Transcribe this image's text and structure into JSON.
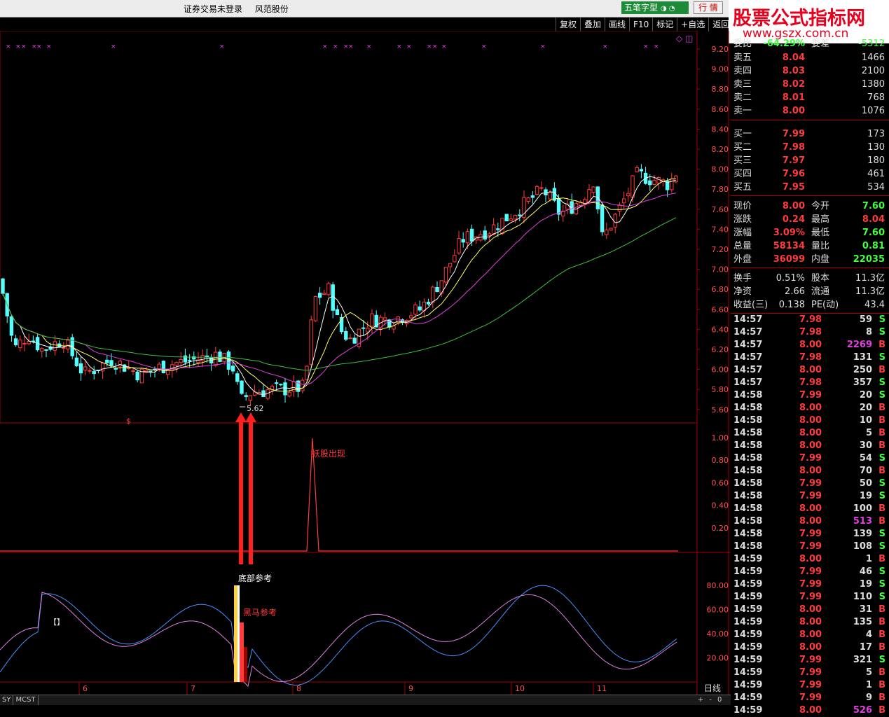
{
  "window": {
    "title_items": [
      "证券交易未登录",
      "风范股份"
    ],
    "ime_label": "五笔字型",
    "market_button": "行 情"
  },
  "logo": {
    "line1": "股票公式指标网",
    "line2": "www.gszx.com.cn"
  },
  "toolbar": [
    "复权",
    "叠加",
    "画线",
    "F10",
    "标记",
    "+自选",
    "返回"
  ],
  "price_axis": [
    "9.20",
    "9.00",
    "8.80",
    "8.60",
    "8.40",
    "8.20",
    "8.00",
    "7.80",
    "7.60",
    "7.40",
    "7.20",
    "7.00",
    "6.80",
    "6.60",
    "6.40",
    "6.20",
    "6.00",
    "5.80",
    "5.60"
  ],
  "ind1_axis": [
    "1.00",
    "0.80",
    "0.60",
    "0.40",
    "0.20"
  ],
  "ind2_axis": [
    "80.00",
    "60.00",
    "40.00",
    "20.00"
  ],
  "month_labels": [
    "6",
    "7",
    "8",
    "9",
    "10",
    "11"
  ],
  "period_label": "日线",
  "chart_labels": {
    "low_price": "5.62",
    "dollar": "$",
    "monster": "妖股出现",
    "bottom_ref": "底部参考",
    "darkhorse_ref": "黑马参考",
    "bracket": "【】"
  },
  "bottom_tabs": [
    "SY",
    "MCST"
  ],
  "bottom_buttons": [
    "+",
    "-",
    "0"
  ],
  "weibi": {
    "label1": "委比",
    "val1": "-64.29%",
    "label2": "委差",
    "val2": "-5312"
  },
  "asks": [
    {
      "label": "卖五",
      "price": "8.04",
      "vol": "1466"
    },
    {
      "label": "卖四",
      "price": "8.03",
      "vol": "2100"
    },
    {
      "label": "卖三",
      "price": "8.02",
      "vol": "1380"
    },
    {
      "label": "卖二",
      "price": "8.01",
      "vol": "768"
    },
    {
      "label": "卖一",
      "price": "8.00",
      "vol": "1076"
    }
  ],
  "bids": [
    {
      "label": "买一",
      "price": "7.99",
      "vol": "173"
    },
    {
      "label": "买二",
      "price": "7.98",
      "vol": "130"
    },
    {
      "label": "买三",
      "price": "7.97",
      "vol": "180"
    },
    {
      "label": "买四",
      "price": "7.96",
      "vol": "461"
    },
    {
      "label": "买五",
      "price": "7.95",
      "vol": "534"
    }
  ],
  "stats": [
    {
      "l1": "现价",
      "v1": "8.00",
      "c1": "red",
      "l2": "今开",
      "v2": "7.60",
      "c2": "green"
    },
    {
      "l1": "涨跌",
      "v1": "0.24",
      "c1": "red",
      "l2": "最高",
      "v2": "8.04",
      "c2": "red"
    },
    {
      "l1": "涨幅",
      "v1": "3.09%",
      "c1": "red",
      "l2": "最低",
      "v2": "7.60",
      "c2": "green"
    },
    {
      "l1": "总量",
      "v1": "58134",
      "c1": "red",
      "l2": "量比",
      "v2": "0.81",
      "c2": "green"
    },
    {
      "l1": "外盘",
      "v1": "36099",
      "c1": "red",
      "l2": "内盘",
      "v2": "22035",
      "c2": "green"
    }
  ],
  "fundamentals": [
    {
      "l1": "换手",
      "v1": "0.51%",
      "l2": "股本",
      "v2": "11.3亿"
    },
    {
      "l1": "净资",
      "v1": "2.66",
      "l2": "流通",
      "v2": "11.3亿"
    },
    {
      "l1": "收益(三)",
      "v1": "0.138",
      "l2": "PE(动)",
      "v2": "43.4"
    }
  ],
  "ticks": [
    {
      "t": "14:57",
      "p": "7.98",
      "v": "59",
      "s": "S"
    },
    {
      "t": "14:57",
      "p": "7.98",
      "v": "8",
      "s": "S"
    },
    {
      "t": "14:57",
      "p": "8.00",
      "v": "2269",
      "s": "B"
    },
    {
      "t": "14:57",
      "p": "7.98",
      "v": "131",
      "s": "S"
    },
    {
      "t": "14:57",
      "p": "8.00",
      "v": "250",
      "s": "B"
    },
    {
      "t": "14:57",
      "p": "7.98",
      "v": "357",
      "s": "S"
    },
    {
      "t": "14:58",
      "p": "7.99",
      "v": "20",
      "s": "S"
    },
    {
      "t": "14:58",
      "p": "8.00",
      "v": "20",
      "s": "B"
    },
    {
      "t": "14:58",
      "p": "8.00",
      "v": "10",
      "s": "B"
    },
    {
      "t": "14:58",
      "p": "8.00",
      "v": "5",
      "s": "B"
    },
    {
      "t": "14:58",
      "p": "8.00",
      "v": "30",
      "s": "B"
    },
    {
      "t": "14:58",
      "p": "7.99",
      "v": "54",
      "s": "S"
    },
    {
      "t": "14:58",
      "p": "8.00",
      "v": "70",
      "s": "B"
    },
    {
      "t": "14:58",
      "p": "7.99",
      "v": "50",
      "s": "S"
    },
    {
      "t": "14:58",
      "p": "7.99",
      "v": "19",
      "s": "S"
    },
    {
      "t": "14:58",
      "p": "8.00",
      "v": "100",
      "s": "B"
    },
    {
      "t": "14:58",
      "p": "8.00",
      "v": "513",
      "s": "B"
    },
    {
      "t": "14:58",
      "p": "7.99",
      "v": "139",
      "s": "S"
    },
    {
      "t": "14:58",
      "p": "7.99",
      "v": "108",
      "s": "S"
    },
    {
      "t": "14:59",
      "p": "8.00",
      "v": "1",
      "s": "B"
    },
    {
      "t": "14:59",
      "p": "7.99",
      "v": "46",
      "s": "S"
    },
    {
      "t": "14:59",
      "p": "7.99",
      "v": "19",
      "s": "S"
    },
    {
      "t": "14:59",
      "p": "7.99",
      "v": "110",
      "s": "S"
    },
    {
      "t": "14:59",
      "p": "8.00",
      "v": "31",
      "s": "B"
    },
    {
      "t": "14:59",
      "p": "8.00",
      "v": "135",
      "s": "B"
    },
    {
      "t": "14:59",
      "p": "8.00",
      "v": "4",
      "s": "B"
    },
    {
      "t": "14:59",
      "p": "8.00",
      "v": "17",
      "s": "B"
    },
    {
      "t": "14:59",
      "p": "7.99",
      "v": "321",
      "s": "S"
    },
    {
      "t": "14:59",
      "p": "7.99",
      "v": "5",
      "s": "B"
    },
    {
      "t": "14:59",
      "p": "7.99",
      "v": "1",
      "s": "B"
    },
    {
      "t": "14:59",
      "p": "7.99",
      "v": "9",
      "s": "B"
    },
    {
      "t": "14:59",
      "p": "8.00",
      "v": "526",
      "s": "B"
    }
  ],
  "colors": {
    "up": "#ff3b3b",
    "down": "#54ffff",
    "ma5": "#ffffff",
    "ma10": "#ffff60",
    "ma20": "#e040e0",
    "ma60": "#40c040",
    "buy": "#ff3b3b",
    "sell": "#40ff40",
    "big": "#e040e0",
    "grid": "#a00000"
  }
}
